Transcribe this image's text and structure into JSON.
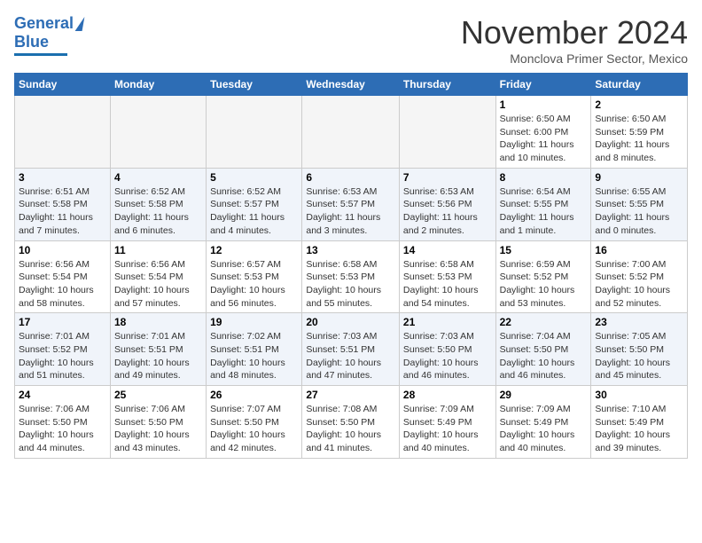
{
  "header": {
    "logo_line1": "General",
    "logo_line2": "Blue",
    "month_title": "November 2024",
    "subtitle": "Monclova Primer Sector, Mexico"
  },
  "calendar": {
    "days_of_week": [
      "Sunday",
      "Monday",
      "Tuesday",
      "Wednesday",
      "Thursday",
      "Friday",
      "Saturday"
    ],
    "weeks": [
      [
        {
          "day": "",
          "empty": true
        },
        {
          "day": "",
          "empty": true
        },
        {
          "day": "",
          "empty": true
        },
        {
          "day": "",
          "empty": true
        },
        {
          "day": "",
          "empty": true
        },
        {
          "day": "1",
          "sunrise": "Sunrise: 6:50 AM",
          "sunset": "Sunset: 6:00 PM",
          "daylight": "Daylight: 11 hours and 10 minutes."
        },
        {
          "day": "2",
          "sunrise": "Sunrise: 6:50 AM",
          "sunset": "Sunset: 5:59 PM",
          "daylight": "Daylight: 11 hours and 8 minutes."
        }
      ],
      [
        {
          "day": "3",
          "sunrise": "Sunrise: 6:51 AM",
          "sunset": "Sunset: 5:58 PM",
          "daylight": "Daylight: 11 hours and 7 minutes."
        },
        {
          "day": "4",
          "sunrise": "Sunrise: 6:52 AM",
          "sunset": "Sunset: 5:58 PM",
          "daylight": "Daylight: 11 hours and 6 minutes."
        },
        {
          "day": "5",
          "sunrise": "Sunrise: 6:52 AM",
          "sunset": "Sunset: 5:57 PM",
          "daylight": "Daylight: 11 hours and 4 minutes."
        },
        {
          "day": "6",
          "sunrise": "Sunrise: 6:53 AM",
          "sunset": "Sunset: 5:57 PM",
          "daylight": "Daylight: 11 hours and 3 minutes."
        },
        {
          "day": "7",
          "sunrise": "Sunrise: 6:53 AM",
          "sunset": "Sunset: 5:56 PM",
          "daylight": "Daylight: 11 hours and 2 minutes."
        },
        {
          "day": "8",
          "sunrise": "Sunrise: 6:54 AM",
          "sunset": "Sunset: 5:55 PM",
          "daylight": "Daylight: 11 hours and 1 minute."
        },
        {
          "day": "9",
          "sunrise": "Sunrise: 6:55 AM",
          "sunset": "Sunset: 5:55 PM",
          "daylight": "Daylight: 11 hours and 0 minutes."
        }
      ],
      [
        {
          "day": "10",
          "sunrise": "Sunrise: 6:56 AM",
          "sunset": "Sunset: 5:54 PM",
          "daylight": "Daylight: 10 hours and 58 minutes."
        },
        {
          "day": "11",
          "sunrise": "Sunrise: 6:56 AM",
          "sunset": "Sunset: 5:54 PM",
          "daylight": "Daylight: 10 hours and 57 minutes."
        },
        {
          "day": "12",
          "sunrise": "Sunrise: 6:57 AM",
          "sunset": "Sunset: 5:53 PM",
          "daylight": "Daylight: 10 hours and 56 minutes."
        },
        {
          "day": "13",
          "sunrise": "Sunrise: 6:58 AM",
          "sunset": "Sunset: 5:53 PM",
          "daylight": "Daylight: 10 hours and 55 minutes."
        },
        {
          "day": "14",
          "sunrise": "Sunrise: 6:58 AM",
          "sunset": "Sunset: 5:53 PM",
          "daylight": "Daylight: 10 hours and 54 minutes."
        },
        {
          "day": "15",
          "sunrise": "Sunrise: 6:59 AM",
          "sunset": "Sunset: 5:52 PM",
          "daylight": "Daylight: 10 hours and 53 minutes."
        },
        {
          "day": "16",
          "sunrise": "Sunrise: 7:00 AM",
          "sunset": "Sunset: 5:52 PM",
          "daylight": "Daylight: 10 hours and 52 minutes."
        }
      ],
      [
        {
          "day": "17",
          "sunrise": "Sunrise: 7:01 AM",
          "sunset": "Sunset: 5:52 PM",
          "daylight": "Daylight: 10 hours and 51 minutes."
        },
        {
          "day": "18",
          "sunrise": "Sunrise: 7:01 AM",
          "sunset": "Sunset: 5:51 PM",
          "daylight": "Daylight: 10 hours and 49 minutes."
        },
        {
          "day": "19",
          "sunrise": "Sunrise: 7:02 AM",
          "sunset": "Sunset: 5:51 PM",
          "daylight": "Daylight: 10 hours and 48 minutes."
        },
        {
          "day": "20",
          "sunrise": "Sunrise: 7:03 AM",
          "sunset": "Sunset: 5:51 PM",
          "daylight": "Daylight: 10 hours and 47 minutes."
        },
        {
          "day": "21",
          "sunrise": "Sunrise: 7:03 AM",
          "sunset": "Sunset: 5:50 PM",
          "daylight": "Daylight: 10 hours and 46 minutes."
        },
        {
          "day": "22",
          "sunrise": "Sunrise: 7:04 AM",
          "sunset": "Sunset: 5:50 PM",
          "daylight": "Daylight: 10 hours and 46 minutes."
        },
        {
          "day": "23",
          "sunrise": "Sunrise: 7:05 AM",
          "sunset": "Sunset: 5:50 PM",
          "daylight": "Daylight: 10 hours and 45 minutes."
        }
      ],
      [
        {
          "day": "24",
          "sunrise": "Sunrise: 7:06 AM",
          "sunset": "Sunset: 5:50 PM",
          "daylight": "Daylight: 10 hours and 44 minutes."
        },
        {
          "day": "25",
          "sunrise": "Sunrise: 7:06 AM",
          "sunset": "Sunset: 5:50 PM",
          "daylight": "Daylight: 10 hours and 43 minutes."
        },
        {
          "day": "26",
          "sunrise": "Sunrise: 7:07 AM",
          "sunset": "Sunset: 5:50 PM",
          "daylight": "Daylight: 10 hours and 42 minutes."
        },
        {
          "day": "27",
          "sunrise": "Sunrise: 7:08 AM",
          "sunset": "Sunset: 5:50 PM",
          "daylight": "Daylight: 10 hours and 41 minutes."
        },
        {
          "day": "28",
          "sunrise": "Sunrise: 7:09 AM",
          "sunset": "Sunset: 5:49 PM",
          "daylight": "Daylight: 10 hours and 40 minutes."
        },
        {
          "day": "29",
          "sunrise": "Sunrise: 7:09 AM",
          "sunset": "Sunset: 5:49 PM",
          "daylight": "Daylight: 10 hours and 40 minutes."
        },
        {
          "day": "30",
          "sunrise": "Sunrise: 7:10 AM",
          "sunset": "Sunset: 5:49 PM",
          "daylight": "Daylight: 10 hours and 39 minutes."
        }
      ]
    ]
  }
}
